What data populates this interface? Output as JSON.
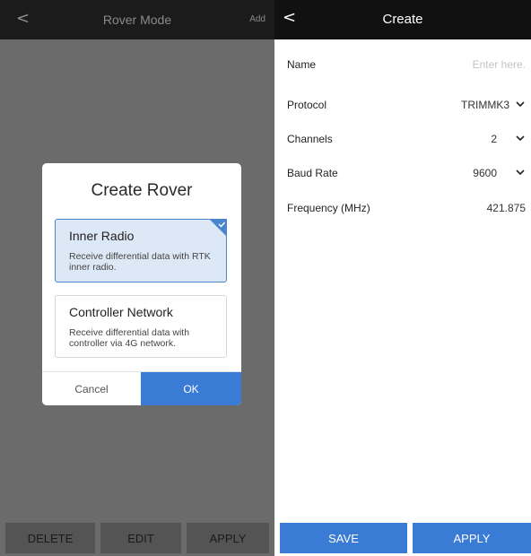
{
  "left": {
    "header": {
      "back_icon": "<",
      "title": "Rover Mode",
      "add_label": "Add"
    },
    "dialog": {
      "title": "Create Rover",
      "options": [
        {
          "title": "Inner Radio",
          "description": "Receive differential data with RTK inner radio.",
          "selected": true
        },
        {
          "title": "Controller Network",
          "description": "Receive differential data with controller via 4G network.",
          "selected": false
        }
      ],
      "cancel_label": "Cancel",
      "ok_label": "OK"
    },
    "bottom": {
      "delete_label": "DELETE",
      "edit_label": "EDIT",
      "apply_label": "APPLY"
    }
  },
  "right": {
    "header": {
      "back_icon": "<",
      "title": "Create"
    },
    "fields": {
      "name": {
        "label": "Name",
        "placeholder": "Enter here."
      },
      "protocol": {
        "label": "Protocol",
        "value": "TRIMMK3"
      },
      "channels": {
        "label": "Channels",
        "value": "2"
      },
      "baud_rate": {
        "label": "Baud Rate",
        "value": "9600"
      },
      "frequency": {
        "label": "Frequency (MHz)",
        "value": "421.875"
      }
    },
    "bottom": {
      "save_label": "SAVE",
      "apply_label": "APPLY"
    }
  },
  "colors": {
    "accent": "#3a7bd5",
    "overlay": "#6b6b6b",
    "header": "#111111"
  }
}
